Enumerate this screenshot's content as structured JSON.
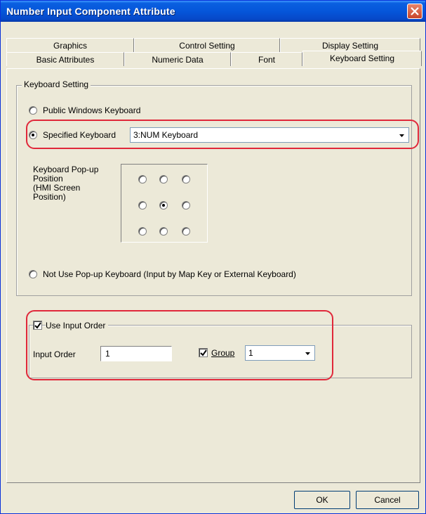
{
  "window": {
    "title": "Number Input Component Attribute",
    "close_icon": "close-icon"
  },
  "tabs": {
    "row_back": [
      "Graphics",
      "Control Setting",
      "Display Setting"
    ],
    "row_front": [
      "Basic Attributes",
      "Numeric Data",
      "Font",
      "Keyboard Setting"
    ],
    "active": "Keyboard Setting"
  },
  "keyboard_setting": {
    "group_label": "Keyboard Setting",
    "public_windows_keyboard": {
      "label": "Public Windows Keyboard",
      "selected": false
    },
    "specified_keyboard": {
      "label": "Specified Keyboard",
      "selected": true,
      "value": "3:NUM Keyboard"
    },
    "popup_position": {
      "label": "Keyboard Pop-up Position (HMI Screen Position)",
      "label_lines": [
        "Keyboard Pop-up",
        "Position",
        "(HMI Screen",
        "Position)"
      ],
      "selected": "middle-center"
    },
    "not_use_popup": {
      "label": "Not Use Pop-up Keyboard (Input by Map Key or External Keyboard)",
      "selected": false
    }
  },
  "input_order": {
    "use_label": "Use Input Order",
    "use_checked": true,
    "order_label": "Input Order",
    "order_value": "1",
    "group_label": "Group",
    "group_checked": true,
    "group_value": "1"
  },
  "footer": {
    "ok_label": "OK",
    "cancel_label": "Cancel"
  },
  "colors": {
    "titlebar": "#0556da",
    "highlight": "#e0283a",
    "dialog_bg": "#ece9d8"
  }
}
